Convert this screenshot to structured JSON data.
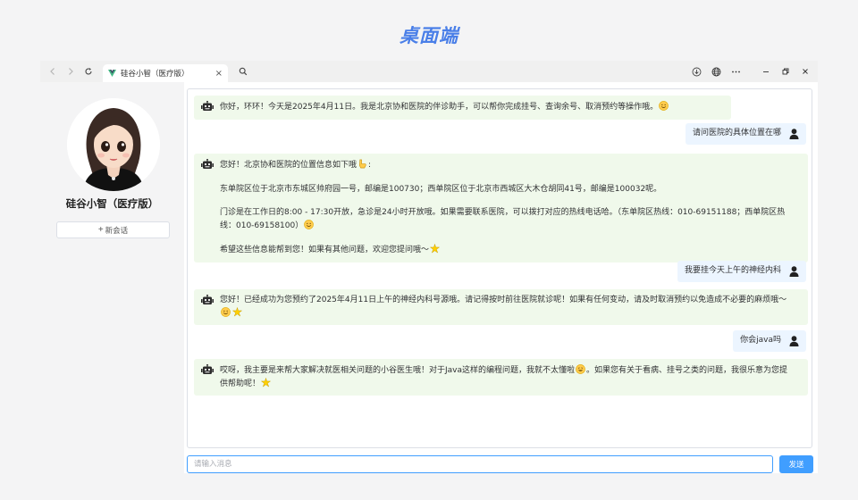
{
  "page_heading": "桌面端",
  "browser": {
    "tab_title": "硅谷小智（医疗版）",
    "tab_close": "×"
  },
  "sidebar": {
    "app_name": "硅谷小智（医疗版）",
    "new_chat_plus": "+",
    "new_chat_label": "新会话"
  },
  "messages": [
    {
      "role": "bot",
      "paragraphs": [
        "你好，环环！今天是2025年4月11日。我是北京协和医院的伴诊助手，可以帮你完成挂号、查询余号、取消预约等操作哦。"
      ],
      "emoji": "smile"
    },
    {
      "role": "user",
      "text": "请问医院的具体位置在哪"
    },
    {
      "role": "bot",
      "paragraphs": [
        "您好！北京协和医院的位置信息如下哦",
        "东单院区位于北京市东城区帅府园一号，邮编是100730；西单院区位于北京市西城区大木仓胡同41号，邮编是100032呢。",
        "门诊是在工作日的8:00 - 17:30开放，急诊是24小时开放哦。如果需要联系医院，可以拨打对应的热线电话哈。（东单院区热线：010-69151188；西单院区热线：010-69158100）",
        "希望这些信息能帮到您！如果有其他问题，欢迎您提问哦～"
      ]
    },
    {
      "role": "user",
      "text": "我要挂今天上午的神经内科"
    },
    {
      "role": "bot",
      "paragraphs": [
        "您好！已经成功为您预约了2025年4月11日上午的神经内科号源哦。请记得按时前往医院就诊呢！如果有任何变动，请及时取消预约以免造成不必要的麻烦哦～"
      ]
    },
    {
      "role": "user",
      "text": "你会java吗"
    },
    {
      "role": "bot",
      "paragraphs": [
        "哎呀，我主要是来帮大家解决就医相关问题的小谷医生哦！对于Java这样的编程问题，我就不太懂啦",
        "。如果您有关于看病、挂号之类的问题，我很乐意为您提供帮助呢！"
      ]
    }
  ],
  "input": {
    "placeholder": "请输入消息",
    "value": ""
  },
  "send_button": "发送",
  "colors": {
    "accent": "#409eff",
    "bot_bubble": "#f0f9eb",
    "user_bubble": "#ecf5ff",
    "heading": "#4a7fe8"
  },
  "icons": [
    "back-arrow-icon",
    "forward-arrow-icon",
    "reload-icon",
    "vue-logo-icon",
    "search-icon",
    "download-icon",
    "globe-icon",
    "more-icon",
    "minimize-icon",
    "restore-icon",
    "close-icon",
    "robot-icon",
    "user-icon"
  ]
}
